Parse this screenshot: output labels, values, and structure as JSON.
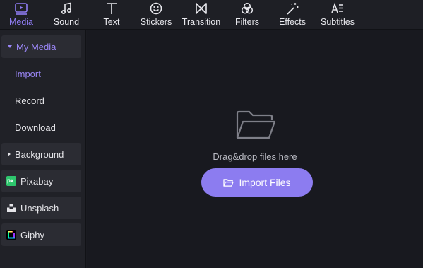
{
  "toolbar": {
    "tabs": [
      {
        "label": "Media",
        "icon": "media-icon",
        "active": true
      },
      {
        "label": "Sound",
        "icon": "music-note-icon"
      },
      {
        "label": "Text",
        "icon": "text-icon"
      },
      {
        "label": "Stickers",
        "icon": "smiley-icon"
      },
      {
        "label": "Transition",
        "icon": "bowtie-transition-icon"
      },
      {
        "label": "Filters",
        "icon": "filter-circles-icon"
      },
      {
        "label": "Effects",
        "icon": "magic-wand-icon"
      },
      {
        "label": "Subtitles",
        "icon": "subtitles-icon"
      }
    ]
  },
  "sidebar": {
    "items": [
      {
        "label": "My Media"
      },
      {
        "label": "Import"
      },
      {
        "label": "Record"
      },
      {
        "label": "Download"
      },
      {
        "label": "Background"
      },
      {
        "label": "Pixabay",
        "icon_text": "px"
      },
      {
        "label": "Unsplash"
      },
      {
        "label": "Giphy"
      }
    ]
  },
  "main": {
    "drop_text": "Drag&drop files here",
    "import_button": "Import Files"
  },
  "colors": {
    "accent": "#8c7cf0",
    "background": "#18191f",
    "sidebar": "#202127",
    "pixabay_green": "#2ec66d"
  }
}
